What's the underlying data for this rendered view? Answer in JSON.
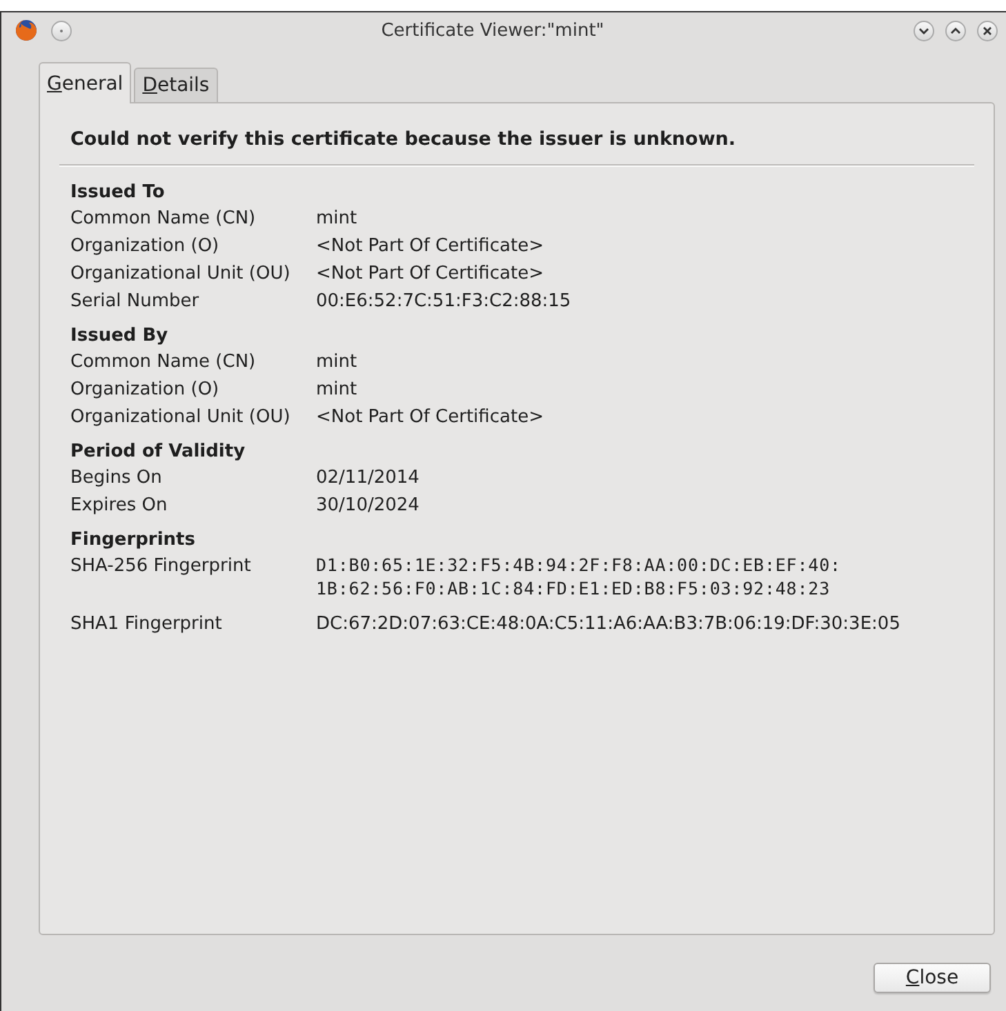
{
  "window": {
    "title": "Certificate Viewer:\"mint\""
  },
  "tabs": [
    {
      "label": "General",
      "selected": true
    },
    {
      "label": "Details",
      "selected": false
    }
  ],
  "warning": "Could not verify this certificate because the issuer is unknown.",
  "sections": [
    {
      "title": "Issued To",
      "rows": [
        {
          "label": "Common Name (CN)",
          "value": [
            "mint"
          ]
        },
        {
          "label": "Organization (O)",
          "value": [
            "<Not Part Of Certificate>"
          ]
        },
        {
          "label": "Organizational Unit (OU)",
          "value": [
            "<Not Part Of Certificate>"
          ]
        },
        {
          "label": "Serial Number",
          "value": [
            "00:E6:52:7C:51:F3:C2:88:15"
          ]
        }
      ]
    },
    {
      "title": "Issued By",
      "rows": [
        {
          "label": "Common Name (CN)",
          "value": [
            "mint"
          ]
        },
        {
          "label": "Organization (O)",
          "value": [
            "mint"
          ]
        },
        {
          "label": "Organizational Unit (OU)",
          "value": [
            "<Not Part Of Certificate>"
          ]
        }
      ]
    },
    {
      "title": "Period of Validity",
      "rows": [
        {
          "label": "Begins On",
          "value": [
            "02/11/2014"
          ]
        },
        {
          "label": "Expires On",
          "value": [
            "30/10/2024"
          ]
        }
      ]
    },
    {
      "title": "Fingerprints",
      "rows": [
        {
          "label": "SHA-256 Fingerprint",
          "kind": "mono",
          "value": [
            "D1:B0:65:1E:32:F5:4B:94:2F:F8:AA:00:DC:EB:EF:40:",
            "1B:62:56:F0:AB:1C:84:FD:E1:ED:B8:F5:03:92:48:23"
          ]
        },
        {
          "label": "SHA1 Fingerprint",
          "value": [
            "DC:67:2D:07:63:CE:48:0A:C5:11:A6:AA:B3:7B:06:19:DF:30:3E:05"
          ]
        }
      ]
    }
  ],
  "buttons": [
    {
      "label": "Close"
    }
  ]
}
